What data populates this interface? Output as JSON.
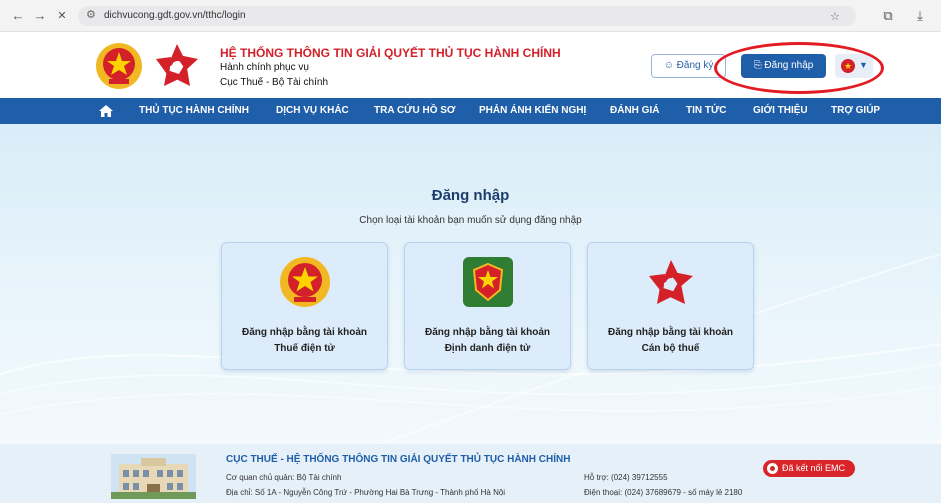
{
  "browser": {
    "url": "dichvucong.gdt.gov.vn/tthc/login",
    "back": "←",
    "forward": "→",
    "reload": "✕"
  },
  "header": {
    "title": "HỆ THỐNG THÔNG TIN GIẢI QUYẾT THỦ TỤC HÀNH CHÍNH",
    "subtitle1": "Hành chính phục vụ",
    "subtitle2": "Cục Thuế - Bộ Tài chính",
    "register_label": "Đăng ký",
    "login_label": "Đăng nhập"
  },
  "menu": {
    "items": [
      "THỦ TỤC HÀNH CHÍNH",
      "DỊCH VỤ KHÁC",
      "TRA CỨU HỒ SƠ",
      "PHẢN ÁNH KIẾN NGHỊ",
      "ĐÁNH GIÁ",
      "TIN TỨC",
      "GIỚI THIỆU",
      "TRỢ GIÚP"
    ]
  },
  "main": {
    "title": "Đăng nhập",
    "subtitle": "Chọn loại tài khoản bạn muốn sử dụng đăng nhập",
    "cards": [
      {
        "line1": "Đăng nhập bằng tài khoản",
        "line2": "Thuế điện tử"
      },
      {
        "line1": "Đăng nhập bằng tài khoản",
        "line2": "Định danh điện tử"
      },
      {
        "line1": "Đăng nhập bằng tài khoản",
        "line2": "Cán bộ thuế"
      }
    ]
  },
  "footer": {
    "title": "CỤC THUẾ - HỆ THỐNG THÔNG TIN GIẢI QUYẾT THỦ TỤC HÀNH CHÍNH",
    "agency": "Cơ quan chủ quản: Bộ Tài chính",
    "address": "Địa chỉ: Số 1A - Nguyễn Công Trứ - Phường Hai Bà Trưng - Thành phố Hà Nội",
    "support": "Hỗ trợ: (024) 39712555",
    "phone": "Điện thoại: (024) 37689679 - số máy lẻ 2180",
    "emc_label": "Đã kết nối EMC"
  },
  "colors": {
    "brand_blue": "#1f5ea8",
    "brand_red": "#d32029",
    "annotation_red": "#e31b23"
  }
}
